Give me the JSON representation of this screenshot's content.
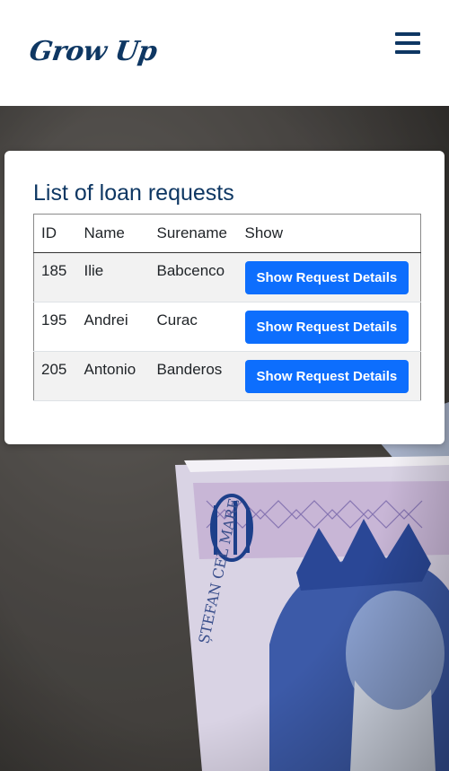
{
  "header": {
    "logo_text": "Grow Up",
    "menu_icon": "hamburger-menu-icon"
  },
  "card": {
    "title": "List of loan requests",
    "table": {
      "columns": [
        "ID",
        "Name",
        "Surename",
        "Show"
      ],
      "rows": [
        {
          "id": "185",
          "name": "Ilie",
          "surname": "Babcenco",
          "action": "Show Request Details"
        },
        {
          "id": "195",
          "name": "Andrei",
          "surname": "Curac",
          "action": "Show Request Details"
        },
        {
          "id": "205",
          "name": "Antonio",
          "surname": "Banderos",
          "action": "Show Request Details"
        }
      ]
    }
  },
  "colors": {
    "brand": "#0e3763",
    "button": "#0d6efd"
  }
}
